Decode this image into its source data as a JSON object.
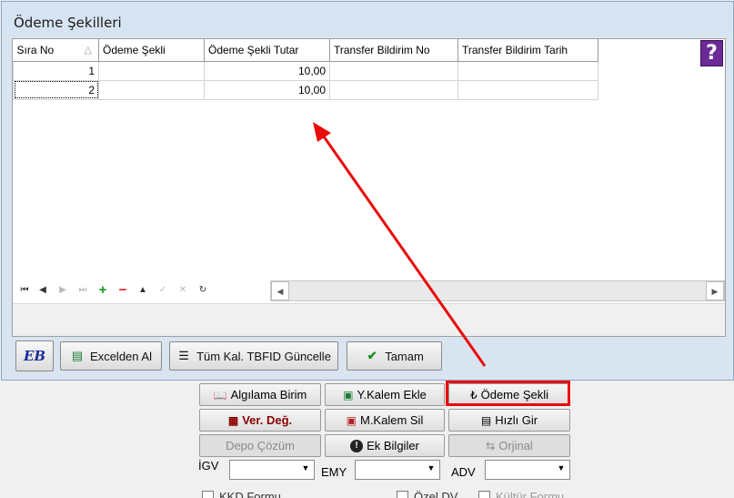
{
  "dialog": {
    "title": "Ödeme Şekilleri",
    "help_icon": "help-question-icon"
  },
  "grid": {
    "columns": [
      "Sıra No",
      "Ödeme Şekli",
      "Ödeme Şekli Tutar",
      "Transfer Bildirim No",
      "Transfer Bildirim Tarih"
    ],
    "rows": [
      {
        "sira": "1",
        "sekil": "",
        "tutar": "10,00",
        "tno": "",
        "ttarih": ""
      },
      {
        "sira": "2",
        "sekil": "",
        "tutar": "10,00",
        "tno": "",
        "ttarih": ""
      }
    ]
  },
  "navigator": {
    "icons": [
      "first-record-icon",
      "prior-record-icon",
      "next-record-icon",
      "last-record-icon",
      "insert-icon",
      "delete-icon",
      "edit-icon",
      "post-icon",
      "cancel-icon",
      "refresh-icon"
    ]
  },
  "footer": {
    "eb_label": "EB",
    "excel_label": "Excelden Al",
    "tum_kal_label": "Tüm Kal. TBFID Güncelle",
    "tamam_label": "Tamam"
  },
  "form": {
    "algilama_label": "Algılama Birim",
    "y_kalem_label": "Y.Kalem Ekle",
    "odeme_sekli_label": "Ödeme Şekli",
    "ver_deg_label": "Ver. Değ.",
    "m_kalem_label": "M.Kalem Sil",
    "hizli_gir_label": "Hızlı Gir",
    "depo_cozum_label": "Depo Çözüm",
    "ek_bilgiler_label": "Ek Bilgiler",
    "orjinal_label": "Orjinal",
    "igv_label": "İGV",
    "emy_label": "EMY",
    "adv_label": "ADV",
    "kkd_label": "KKD Formu",
    "ozel_label": "Özel DV",
    "kultur_label": "Kültür Formu"
  },
  "colors": {
    "highlight": "#ea0b0b",
    "arrow": "#ea0b0b",
    "help_icon_bg": "#6c2a96"
  }
}
